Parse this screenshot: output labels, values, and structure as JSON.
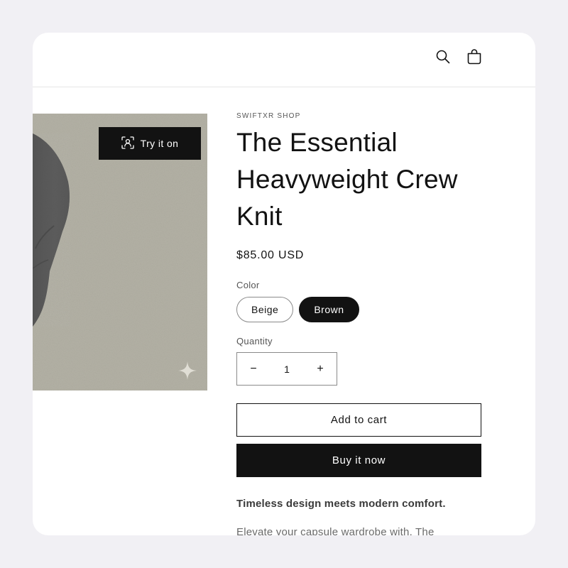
{
  "header": {
    "search_icon": "search-icon",
    "cart_icon": "cart-icon"
  },
  "media": {
    "try_on_label": "Try it on",
    "try_on_icon": "person-scan-icon",
    "sparkle_icon": "sparkle-icon"
  },
  "product": {
    "vendor": "SWIFTXR SHOP",
    "title": "The Essential Heavyweight Crew Knit",
    "price": "$85.00 USD",
    "color_label": "Color",
    "colors": [
      {
        "label": "Beige",
        "selected": false
      },
      {
        "label": "Brown",
        "selected": true
      }
    ],
    "quantity_label": "Quantity",
    "quantity_value": "1",
    "decrease_symbol": "−",
    "increase_symbol": "+",
    "add_to_cart_label": "Add to cart",
    "buy_now_label": "Buy it now",
    "description_heading": "Timeless design meets modern comfort.",
    "description_body": "Elevate your capsule wardrobe with. The"
  },
  "colors": {
    "primary": "#121212",
    "background": "#f1f0f4",
    "card": "#ffffff",
    "photo_backdrop": "#b3b1a5",
    "sweater": "#5a5a5a"
  }
}
